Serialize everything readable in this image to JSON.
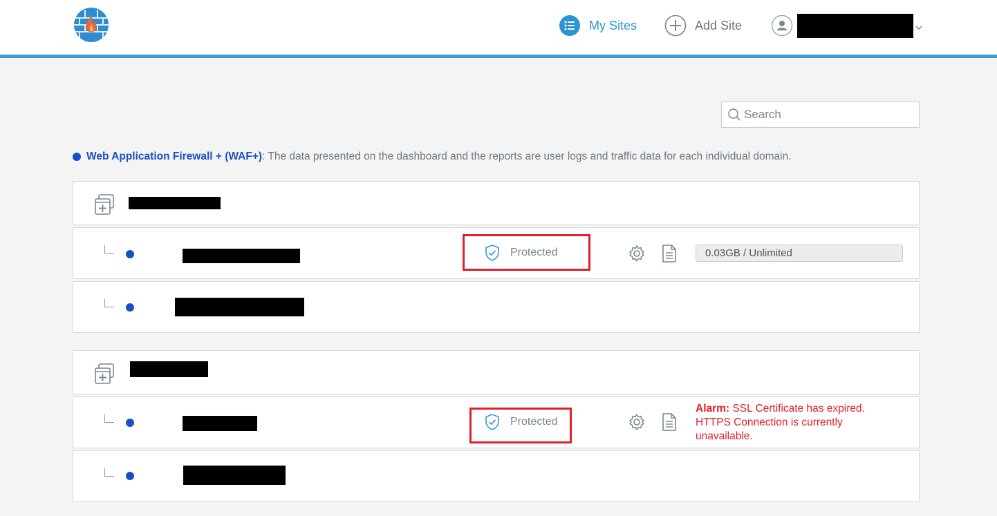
{
  "header": {
    "nav": [
      {
        "label": "My Sites",
        "icon": "list-icon",
        "active": true
      },
      {
        "label": "Add Site",
        "icon": "plus-circle-icon",
        "active": false
      }
    ],
    "user_icon": "user-icon"
  },
  "search": {
    "placeholder": "Search"
  },
  "notice": {
    "title": "Web Application Firewall + (WAF+)",
    "text": ": The data presented on the dashboard and the reports are user logs and traffic data for each individual domain."
  },
  "sites": {
    "site1": {
      "status": "Protected",
      "usage": "0.03GB / Unlimited"
    },
    "site3": {
      "status": "Protected",
      "alarm_label": "Alarm:",
      "alarm_text": " SSL Certificate has expired. HTTPS Connection is currently unavailable."
    }
  },
  "colors": {
    "accent": "#2b95d3",
    "dot": "#1a4fc4",
    "alarm": "#e0202a",
    "highlight": "#e0202a"
  }
}
